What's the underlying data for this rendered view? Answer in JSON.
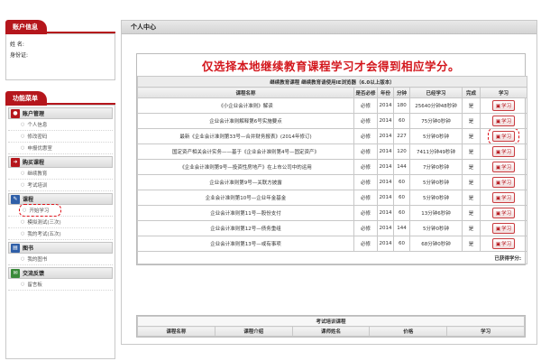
{
  "account": {
    "tab": "账户信息",
    "name_label": "姓 名:",
    "id_label": "身份证:"
  },
  "menu": {
    "tab": "功能菜单",
    "categories": [
      {
        "label": "账户管理",
        "icon": "user-icon",
        "items": [
          "个人信息",
          "修改密码",
          "申报优惠室"
        ]
      },
      {
        "label": "购买课程",
        "icon": "cart-icon",
        "items": [
          "继续教育",
          "考试培训"
        ]
      },
      {
        "label": "课程",
        "icon": "pencil-icon",
        "items": [
          "开始学习",
          "模拟测试(三次)",
          "我的考试(五次)"
        ]
      },
      {
        "label": "图书",
        "icon": "book-icon",
        "items": [
          "我的图书"
        ]
      },
      {
        "label": "交流反馈",
        "icon": "chat-icon",
        "items": [
          "留言板"
        ]
      }
    ]
  },
  "main": {
    "title": "个人中心",
    "notice": "仅选择本地继续教育课程学习才会得到相应学分。",
    "sub_header": "继续教育课程    继续教育请使用IE浏览器（6.0以上版本）",
    "columns": [
      "课程名称",
      "是否必修",
      "年份",
      "分钟",
      "已经学习",
      "完成",
      "学习"
    ],
    "rows": [
      {
        "name": "《小企业会计准则》解读",
        "required": "必修",
        "year": "2014",
        "minutes": "180",
        "studied": "25640分钟48秒钟",
        "done": "是",
        "action": "学习"
      },
      {
        "name": "企业会计准则解释第6号实施要点",
        "required": "必修",
        "year": "2014",
        "minutes": "60",
        "studied": "75分钟0秒钟",
        "done": "是",
        "action": "学习"
      },
      {
        "name": "最新《企业会计准则第33号—合并财务报表》(2014年修订)",
        "required": "必修",
        "year": "2014",
        "minutes": "227",
        "studied": "5分钟0秒钟",
        "done": "是",
        "action": "学习"
      },
      {
        "name": "国定资产相关会计实务——基于《企业会计准则第4号—固定资产》",
        "required": "必修",
        "year": "2014",
        "minutes": "120",
        "studied": "7411分钟49秒钟",
        "done": "是",
        "action": "学习"
      },
      {
        "name": "《企业会计准则第9号—投资性房地产》在上市公司中的运用",
        "required": "必修",
        "year": "2014",
        "minutes": "144",
        "studied": "7分钟0秒钟",
        "done": "是",
        "action": "学习"
      },
      {
        "name": "企业会计准则第9号—关联方披露",
        "required": "必修",
        "year": "2014",
        "minutes": "60",
        "studied": "5分钟0秒钟",
        "done": "是",
        "action": "学习"
      },
      {
        "name": "企业会计准则第10号—企业年金基金",
        "required": "必修",
        "year": "2014",
        "minutes": "60",
        "studied": "5分钟0秒钟",
        "done": "是",
        "action": "学习"
      },
      {
        "name": "企业会计准则第11号—股份支付",
        "required": "必修",
        "year": "2014",
        "minutes": "60",
        "studied": "13分钟6秒钟",
        "done": "是",
        "action": "学习"
      },
      {
        "name": "企业会计准则第12号—债务重组",
        "required": "必修",
        "year": "2014",
        "minutes": "144",
        "studied": "5分钟0秒钟",
        "done": "是",
        "action": "学习"
      },
      {
        "name": "企业会计准则第13号—或有事项",
        "required": "必修",
        "year": "2014",
        "minutes": "60",
        "studied": "68分钟0秒钟",
        "done": "是",
        "action": "学习"
      }
    ],
    "credits_label": "已获得学分:",
    "exam": {
      "title": "考试培训课程",
      "columns": [
        "课程名称",
        "课程介绍",
        "课师姓名",
        "价格",
        "学习"
      ]
    }
  },
  "colors": {
    "brand_red": "#b5161c",
    "notice_red": "#d3171d"
  }
}
